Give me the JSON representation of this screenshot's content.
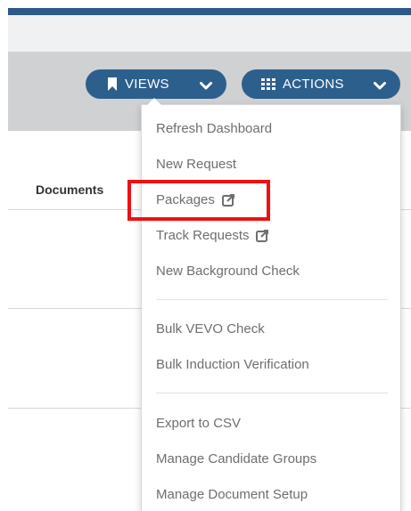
{
  "toolbar": {
    "views_label": "VIEWS",
    "actions_label": "ACTIONS",
    "views_icon": "bookmark-icon",
    "actions_icon": "grid-icon"
  },
  "table": {
    "headers": [
      "Documents"
    ]
  },
  "actions_menu": {
    "groups": [
      [
        {
          "label": "Refresh Dashboard"
        },
        {
          "label": "New Request"
        },
        {
          "label": "Packages",
          "icon": "external-link-icon"
        },
        {
          "label": "Track Requests",
          "icon": "external-link-icon"
        },
        {
          "label": "New Background Check"
        }
      ],
      [
        {
          "label": "Bulk VEVO Check"
        },
        {
          "label": "Bulk Induction Verification"
        }
      ],
      [
        {
          "label": "Export to CSV"
        },
        {
          "label": "Manage Candidate Groups"
        },
        {
          "label": "Manage Document Setup"
        }
      ]
    ]
  },
  "colors": {
    "button_bg": "#2d5f8d",
    "toolbar_bg": "#cfd1d3",
    "header_stripe": "#2b5a8a",
    "highlight": "#ee1111"
  }
}
